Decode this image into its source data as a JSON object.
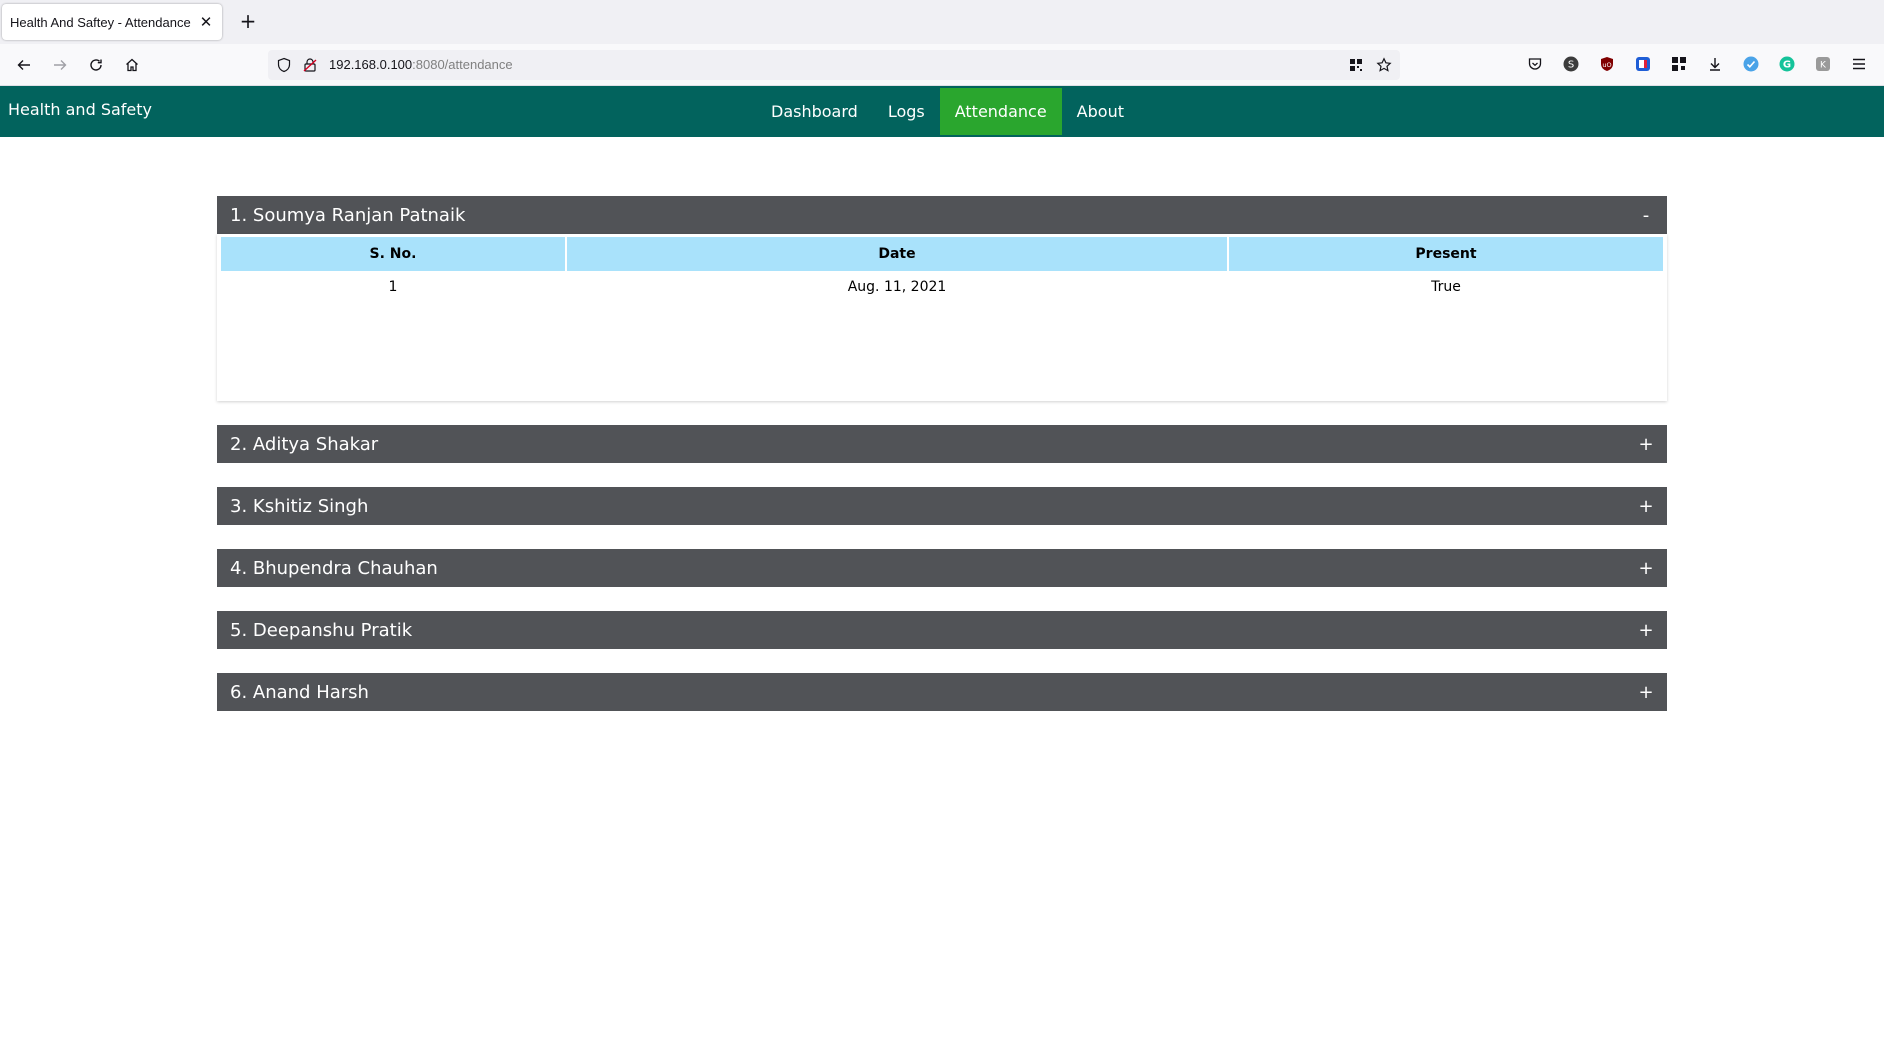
{
  "browser": {
    "tab_title": "Health And Saftey - Attendance",
    "url_host": "192.168.0.100",
    "url_rest": ":8080/attendance"
  },
  "navbar": {
    "brand": "Health and Safety",
    "items": [
      {
        "label": "Dashboard",
        "active": false
      },
      {
        "label": "Logs",
        "active": false
      },
      {
        "label": "Attendance",
        "active": true
      },
      {
        "label": "About",
        "active": false
      }
    ]
  },
  "attendance": {
    "columns": [
      "S. No.",
      "Date",
      "Present"
    ],
    "people": [
      {
        "title": "1. Soumya Ranjan Patnaik",
        "toggle": "-",
        "expanded": true,
        "rows": [
          {
            "sno": "1",
            "date": "Aug. 11, 2021",
            "present": "True"
          }
        ]
      },
      {
        "title": "2. Aditya Shakar",
        "toggle": "+",
        "expanded": false
      },
      {
        "title": "3. Kshitiz Singh",
        "toggle": "+",
        "expanded": false
      },
      {
        "title": "4. Bhupendra Chauhan",
        "toggle": "+",
        "expanded": false
      },
      {
        "title": "5. Deepanshu Pratik",
        "toggle": "+",
        "expanded": false
      },
      {
        "title": "6. Anand Harsh",
        "toggle": "+",
        "expanded": false
      }
    ]
  },
  "colors": {
    "appbar": "#02635d",
    "active_menu": "#2aa62e",
    "accordion_header": "#515357",
    "table_header": "#a9e2fb"
  }
}
